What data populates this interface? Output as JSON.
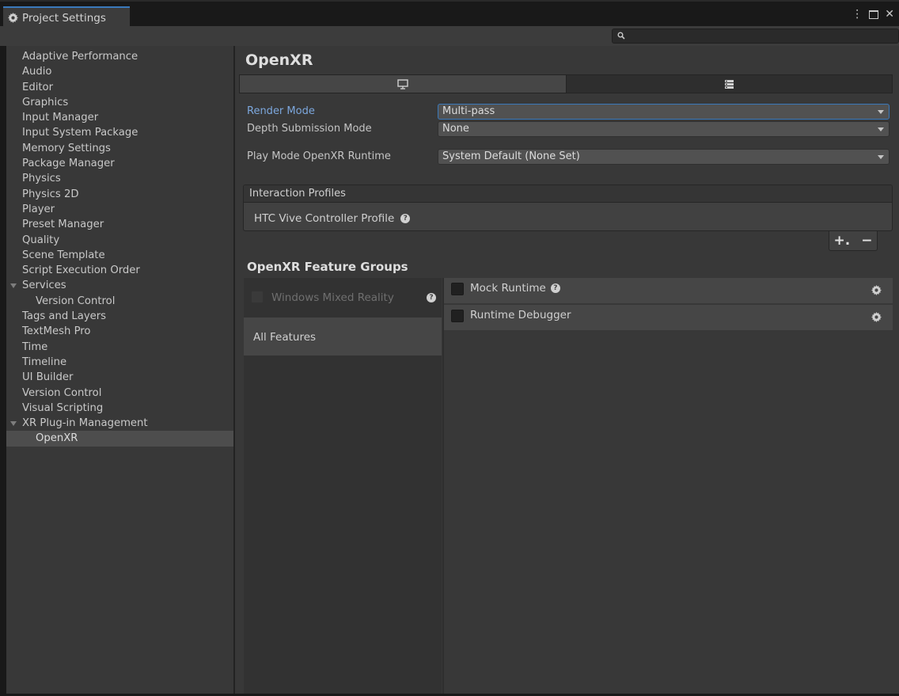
{
  "window": {
    "title": "Project Settings",
    "icons": {
      "tab": "gear-icon",
      "more": "kebab-menu-icon",
      "maximize": "maximize-icon",
      "close": "close-icon"
    },
    "more_glyph": "⋮",
    "close_glyph": "✕"
  },
  "search": {
    "placeholder": "",
    "icon": "search-icon"
  },
  "sidebar": {
    "items": [
      {
        "label": "Adaptive Performance"
      },
      {
        "label": "Audio"
      },
      {
        "label": "Editor"
      },
      {
        "label": "Graphics"
      },
      {
        "label": "Input Manager"
      },
      {
        "label": "Input System Package"
      },
      {
        "label": "Memory Settings"
      },
      {
        "label": "Package Manager"
      },
      {
        "label": "Physics"
      },
      {
        "label": "Physics 2D"
      },
      {
        "label": "Player"
      },
      {
        "label": "Preset Manager"
      },
      {
        "label": "Quality"
      },
      {
        "label": "Scene Template"
      },
      {
        "label": "Script Execution Order"
      },
      {
        "label": "Services"
      },
      {
        "label": "Version Control"
      },
      {
        "label": "Tags and Layers"
      },
      {
        "label": "TextMesh Pro"
      },
      {
        "label": "Time"
      },
      {
        "label": "Timeline"
      },
      {
        "label": "UI Builder"
      },
      {
        "label": "Version Control"
      },
      {
        "label": "Visual Scripting"
      },
      {
        "label": "XR Plug-in Management"
      },
      {
        "label": "OpenXR"
      }
    ]
  },
  "main": {
    "title": "OpenXR",
    "tabs": [
      {
        "icon": "desktop-monitor-icon",
        "active": true
      },
      {
        "icon": "server-rack-icon",
        "active": false
      }
    ],
    "render_mode": {
      "label": "Render Mode",
      "value": "Multi-pass"
    },
    "depth_submission": {
      "label": "Depth Submission Mode",
      "value": "None"
    },
    "runtime": {
      "label": "Play Mode OpenXR Runtime",
      "value": "System Default (None Set)"
    },
    "interaction_profiles": {
      "header": "Interaction Profiles",
      "items": [
        {
          "label": "HTC Vive Controller Profile"
        }
      ],
      "add_label": "+.",
      "remove_label": "−"
    },
    "feature_groups": {
      "title": "OpenXR Feature Groups",
      "groups": [
        {
          "label": "Windows Mixed Reality",
          "enabled": false
        },
        {
          "label": "All Features",
          "selected": true
        }
      ],
      "features": [
        {
          "label": "Mock Runtime",
          "checked": false,
          "has_help": true
        },
        {
          "label": "Runtime Debugger",
          "checked": false,
          "has_help": false
        }
      ]
    }
  },
  "colors": {
    "accent": "#3a79bb",
    "highlight_label": "#7ca7dd",
    "panel": "#383838",
    "background": "#191919"
  }
}
